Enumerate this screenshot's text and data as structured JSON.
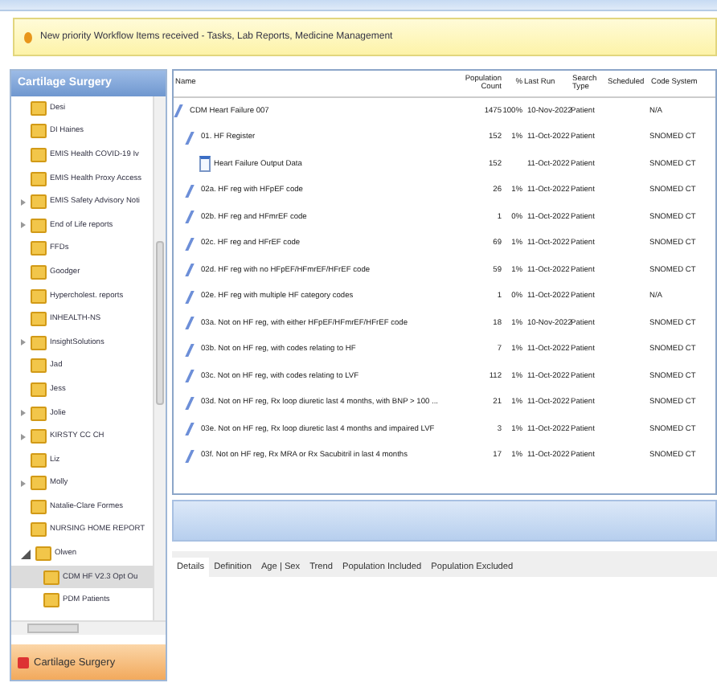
{
  "notification": {
    "text": "New priority Workflow Items received - Tasks, Lab Reports, Medicine Management"
  },
  "sidebar": {
    "title": "Cartilage Surgery",
    "items": [
      {
        "label": "Desi"
      },
      {
        "label": "DI Haines"
      },
      {
        "label": "EMIS Health COVID-19 Iv"
      },
      {
        "label": "EMIS Health Proxy Access"
      },
      {
        "label": "EMIS Safety Advisory Noti",
        "expanded": false
      },
      {
        "label": "End of Life reports",
        "expanded": false
      },
      {
        "label": "FFDs"
      },
      {
        "label": "Goodger"
      },
      {
        "label": "Hypercholest. reports"
      },
      {
        "label": "INHEALTH-NS"
      },
      {
        "label": "InsightSolutions",
        "expanded": false
      },
      {
        "label": "Jad"
      },
      {
        "label": "Jess"
      },
      {
        "label": "Jolie",
        "expanded": false
      },
      {
        "label": "KIRSTY CC CH",
        "expanded": false
      },
      {
        "label": "Liz"
      },
      {
        "label": "Molly",
        "expanded": false
      },
      {
        "label": "Natalie-Clare Formes"
      },
      {
        "label": "NURSING HOME REPORT"
      },
      {
        "label": "Olwen",
        "expanded": true,
        "children": [
          {
            "label": "CDM HF V2.3 Opt Ou",
            "selected": true
          },
          {
            "label": "PDM Patients",
            "selected": false
          }
        ]
      }
    ],
    "footer_button": "Cartilage Surgery"
  },
  "table": {
    "columns": [
      "Name",
      "Population Count",
      "%",
      "Last Run",
      "Search Type",
      "Scheduled",
      "Code System"
    ],
    "rows": [
      {
        "kind": "search",
        "cells": [
          "CDM Heart Failure 007",
          "1475",
          "100%",
          "10-Nov-2022",
          "Patient",
          "",
          "N/A"
        ],
        "children": [
          {
            "kind": "search",
            "cells": [
              "01. HF Register",
              "152",
              "1%",
              "11-Oct-2022",
              "Patient",
              "",
              "SNOMED CT"
            ],
            "children": [
              {
                "kind": "report",
                "cells": [
                  "Heart Failure Output Data",
                  "152",
                  "",
                  "11-Oct-2022",
                  "Patient",
                  "",
                  "SNOMED CT"
                ]
              }
            ]
          },
          {
            "kind": "search",
            "cells": [
              "02a. HF reg with HFpEF code",
              "26",
              "1%",
              "11-Oct-2022",
              "Patient",
              "",
              "SNOMED CT"
            ]
          },
          {
            "kind": "search",
            "cells": [
              "02b. HF reg and HFmrEF code",
              "1",
              "0%",
              "11-Oct-2022",
              "Patient",
              "",
              "SNOMED CT"
            ]
          },
          {
            "kind": "search",
            "cells": [
              "02c. HF reg and HFrEF code",
              "69",
              "1%",
              "11-Oct-2022",
              "Patient",
              "",
              "SNOMED CT"
            ]
          },
          {
            "kind": "search",
            "cells": [
              "02d. HF reg with no HFpEF/HFmrEF/HFrEF code",
              "59",
              "1%",
              "11-Oct-2022",
              "Patient",
              "",
              "SNOMED CT"
            ]
          },
          {
            "kind": "search",
            "cells": [
              "02e. HF reg with multiple HF category codes",
              "1",
              "0%",
              "11-Oct-2022",
              "Patient",
              "",
              "N/A"
            ]
          },
          {
            "kind": "search",
            "cells": [
              "03a. Not on HF reg, with either HFpEF/HFmrEF/HFrEF code",
              "18",
              "1%",
              "10-Nov-2022",
              "Patient",
              "",
              "SNOMED CT"
            ]
          },
          {
            "kind": "search",
            "cells": [
              "03b. Not on HF reg, with codes relating to HF",
              "7",
              "1%",
              "11-Oct-2022",
              "Patient",
              "",
              "SNOMED CT"
            ]
          },
          {
            "kind": "search",
            "cells": [
              "03c. Not on HF reg, with codes relating to LVF",
              "112",
              "1%",
              "11-Oct-2022",
              "Patient",
              "",
              "SNOMED CT"
            ]
          },
          {
            "kind": "search",
            "cells": [
              "03d. Not on HF reg, Rx loop diuretic last 4 months, with BNP > 100 ...",
              "21",
              "1%",
              "11-Oct-2022",
              "Patient",
              "",
              "SNOMED CT"
            ]
          },
          {
            "kind": "search",
            "cells": [
              "03e. Not on HF reg, Rx loop diuretic last 4 months and impaired LVF",
              "3",
              "1%",
              "11-Oct-2022",
              "Patient",
              "",
              "SNOMED CT"
            ]
          },
          {
            "kind": "search",
            "cells": [
              "03f. Not on HF reg, Rx MRA or Rx Sacubitril in last 4 months",
              "17",
              "1%",
              "11-Oct-2022",
              "Patient",
              "",
              "SNOMED CT"
            ]
          }
        ]
      }
    ]
  },
  "detail_tabs": [
    {
      "label": "Details",
      "selected": true
    },
    {
      "label": "Definition",
      "selected": false
    },
    {
      "label": "Age | Sex",
      "selected": false
    },
    {
      "label": "Trend",
      "selected": false
    },
    {
      "label": "Population Included",
      "selected": false
    },
    {
      "label": "Population Excluded",
      "selected": false
    }
  ]
}
